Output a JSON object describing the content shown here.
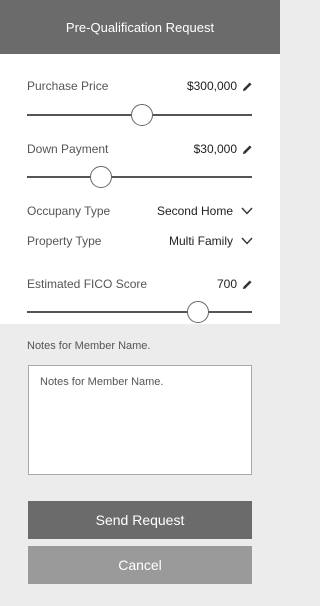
{
  "header": {
    "title": "Pre-Qualification Request"
  },
  "purchase_price": {
    "label": "Purchase Price",
    "value": "$300,000",
    "slider_fraction": 0.51
  },
  "down_payment": {
    "label": "Down Payment",
    "value": "$30,000",
    "slider_fraction": 0.33
  },
  "occupancy": {
    "label": "Occupany Type",
    "value": "Second Home"
  },
  "property": {
    "label": "Property Type",
    "value": "Multi Family"
  },
  "fico": {
    "label": "Estimated FICO Score",
    "value": "700",
    "slider_fraction": 0.76
  },
  "notes": {
    "label": "Notes for Member Name.",
    "placeholder": "Notes for Member Name."
  },
  "buttons": {
    "send": "Send Request",
    "cancel": "Cancel"
  },
  "icons": {
    "edit": "pencil-icon",
    "dropdown": "chevron-down-icon"
  },
  "colors": {
    "header_bg": "#6b6b6b",
    "send_bg": "#6b6b6b",
    "cancel_bg": "#9a9a9a"
  }
}
